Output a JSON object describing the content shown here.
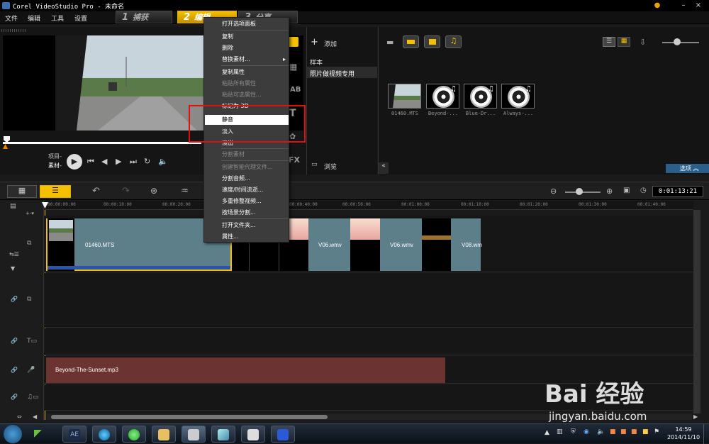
{
  "window": {
    "title": "Corel VideoStudio Pro - 未命名",
    "minimize": "–",
    "close": "×"
  },
  "menu": [
    "文件",
    "编辑",
    "工具",
    "设置"
  ],
  "steps": [
    {
      "num": "1",
      "label": "捕获"
    },
    {
      "num": "2",
      "label": "编辑"
    },
    {
      "num": "3",
      "label": "分享"
    }
  ],
  "preview": {
    "project_label": "项目-",
    "clip_label": "素材-"
  },
  "library": {
    "add_label": "添加",
    "folders": [
      "样本",
      "照片做视频专用"
    ],
    "browse_label": "浏览",
    "options_label": "选项",
    "items": [
      {
        "label": "01460.MTS"
      },
      {
        "label": "Beyond-..."
      },
      {
        "label": "Blue-Dr..."
      },
      {
        "label": "Always-..."
      }
    ]
  },
  "timecode": "0:01:13:21",
  "ruler_ticks": [
    "00:00:00:00",
    "00:00:10:00",
    "00:00:20:00",
    "00:00:40:00",
    "00:00:50:00",
    "00:01:00:00",
    "00:01:10:00",
    "00:01:20:00",
    "00:01:30:00",
    "00:01:40:00"
  ],
  "clips": {
    "main": "01460.MTS",
    "v06a": "V06.wmv",
    "v06b": "V06.wmv",
    "v08": "V08.wm"
  },
  "audio_clip": "Beyond-The-Sunset.mp3",
  "context_menu": {
    "items": [
      {
        "label": "打开选项面板",
        "enabled": true
      },
      {
        "label": "复制",
        "enabled": true
      },
      {
        "label": "删除",
        "enabled": true
      },
      {
        "label": "替换素材...",
        "enabled": true,
        "submenu": "▸"
      },
      {
        "label": "复制属性",
        "enabled": true
      },
      {
        "label": "粘贴所有属性",
        "enabled": false
      },
      {
        "label": "粘贴可选属性...",
        "enabled": false
      },
      {
        "label": "标记为 3D",
        "enabled": true
      },
      {
        "label": "静音",
        "enabled": true,
        "highlighted": true
      },
      {
        "label": "淡入",
        "enabled": true
      },
      {
        "label": "淡出",
        "enabled": true
      },
      {
        "label": "分割素材",
        "enabled": false
      },
      {
        "label": "创建智能代理文件...",
        "enabled": false
      },
      {
        "label": "分割音频...",
        "enabled": true
      },
      {
        "label": "速度/时间流逝...",
        "enabled": true
      },
      {
        "label": "多重修整视频...",
        "enabled": true
      },
      {
        "label": "按场景分割...",
        "enabled": true
      },
      {
        "label": "打开文件夹...",
        "enabled": true
      },
      {
        "label": "属性...",
        "enabled": true
      }
    ]
  },
  "taskbar": {
    "time": "14:59",
    "date": "2014/11/10",
    "ae_label": "AE"
  },
  "watermark": {
    "logo": "Bai 经验",
    "url": "jingyan.baidu.com"
  },
  "colors": {
    "accent": "#f5c000",
    "clip": "#5d7f8a",
    "audio": "#6b3430",
    "highlight_box": "#e01010"
  }
}
